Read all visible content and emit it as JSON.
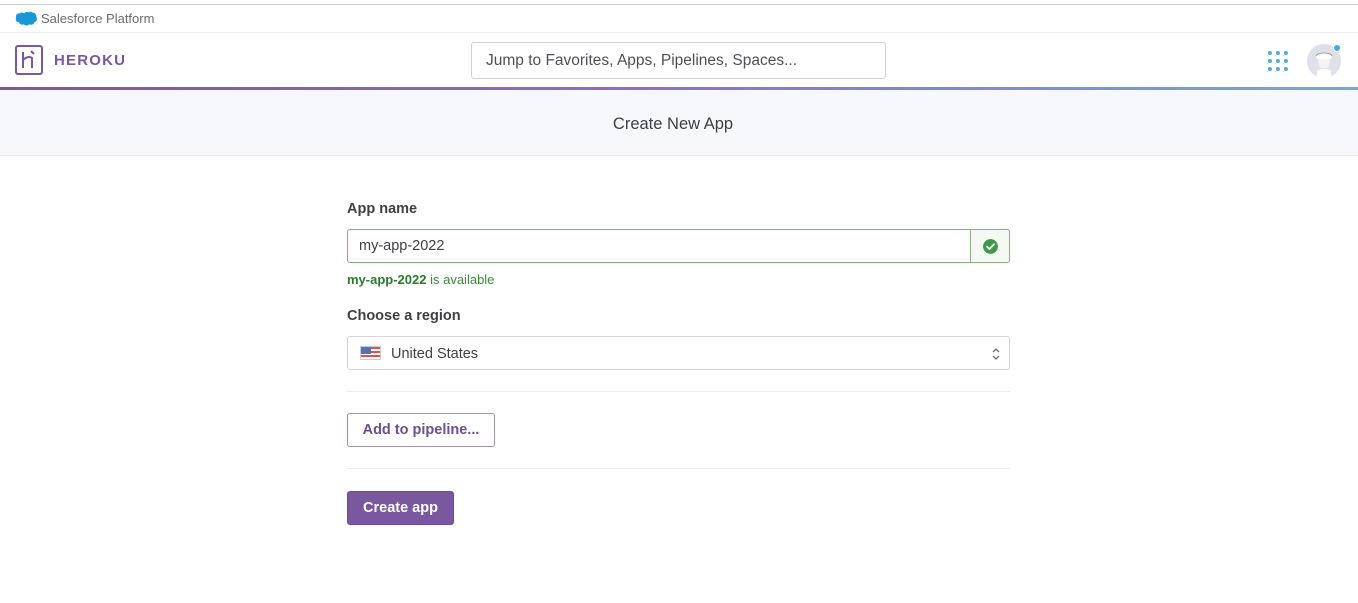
{
  "salesforce_bar": {
    "label": "Salesforce Platform",
    "cloud_icon": "salesforce-cloud-icon"
  },
  "nav": {
    "logo_icon": "heroku-logo-icon",
    "logo_text": "HEROKU",
    "search_placeholder": "Jump to Favorites, Apps, Pipelines, Spaces...",
    "apps_icon": "apps-grid-icon",
    "avatar_icon": "user-avatar-icon"
  },
  "page": {
    "title": "Create New App"
  },
  "form": {
    "app_name_label": "App name",
    "app_name_value": "my-app-2022",
    "valid_icon": "check-circle-icon",
    "availability_name": "my-app-2022",
    "availability_suffix": " is available",
    "region_label": "Choose a region",
    "region_value": "United States",
    "region_flag_icon": "us-flag-icon",
    "region_caret_icon": "select-caret-icon",
    "add_pipeline_label": "Add to pipeline...",
    "create_label": "Create app"
  },
  "colors": {
    "brand_purple": "#79589f",
    "success_green": "#3c9a4a",
    "accent_blue": "#57a9d8"
  }
}
